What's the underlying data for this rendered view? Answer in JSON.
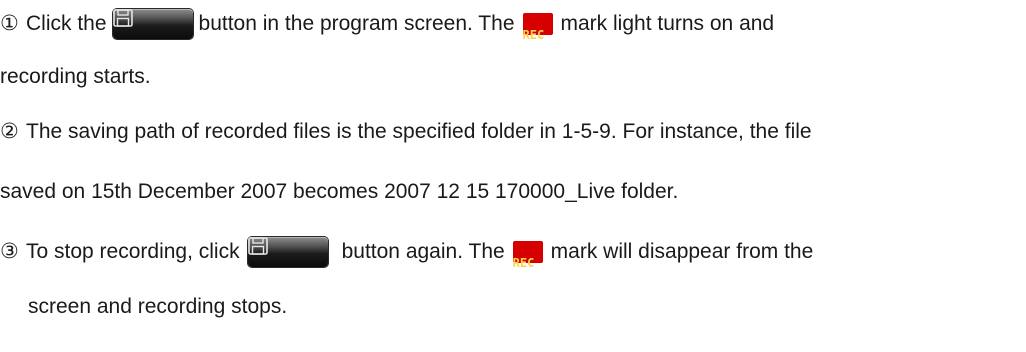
{
  "instructions": {
    "step1": {
      "marker": "①",
      "text_before_button": "Click the",
      "text_after_button": "button in the program screen. The",
      "text_after_badge": "mark light turns on and",
      "continuation": "recording starts."
    },
    "step2": {
      "marker": "②",
      "line1": "The saving path of recorded files is the specified folder in 1-5-9. For instance, the file",
      "line2": "saved on 15th December 2007 becomes 2007 12 15 170000_Live folder."
    },
    "step3": {
      "marker": "③",
      "text_before_button": "To stop recording, click",
      "text_after_button": "button again. The",
      "text_after_badge": "mark will disappear from the",
      "continuation": "screen and recording stops."
    }
  },
  "rec_badge": {
    "label": "REC",
    "background_color": "#d60000",
    "text_color": "#ffd24a"
  },
  "save_button": {
    "icon": "floppy-disk-icon"
  }
}
